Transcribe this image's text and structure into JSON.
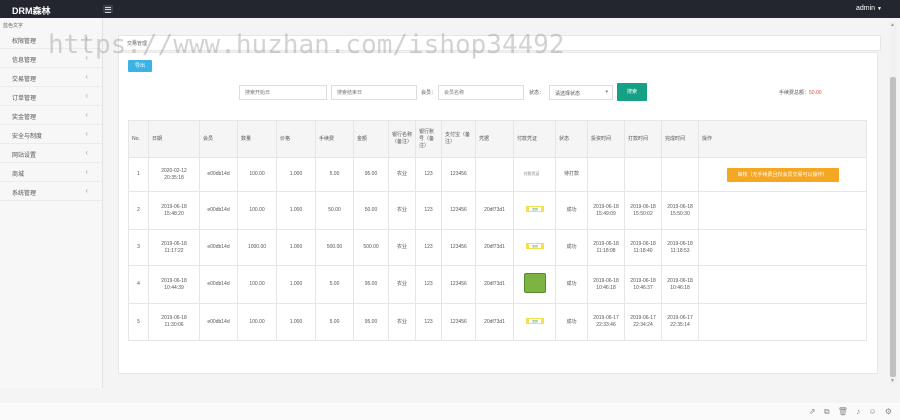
{
  "app": {
    "title": "DRM森林",
    "user": "admin"
  },
  "sidebar": {
    "title": "蓝色文字",
    "items": [
      {
        "label": "权限管理"
      },
      {
        "label": "信息管理"
      },
      {
        "label": "交易管理"
      },
      {
        "label": "订单管理"
      },
      {
        "label": "奖金管理"
      },
      {
        "label": "安全与制度"
      },
      {
        "label": "网站设置"
      },
      {
        "label": "商城"
      },
      {
        "label": "系统管理"
      }
    ]
  },
  "tab": {
    "label": "交易管理"
  },
  "toolbar": {
    "export_label": "导出"
  },
  "search": {
    "start_placeholder": "搜索开始日",
    "end_placeholder": "搜索结束日",
    "member_label": "会员：",
    "member_placeholder": "会员名称",
    "status_label": "状态：",
    "status_value": "请选择状态",
    "search_label": "搜索"
  },
  "summary": {
    "fee_label": "手续费总额：",
    "fee_value": "50.00"
  },
  "table": {
    "columns": [
      "No.",
      "日期",
      "会员",
      "数量",
      "价格",
      "手续费",
      "金额",
      "银行名称（备注）",
      "银行账号（备注）",
      "支付宝（备注）",
      "凭据",
      "付款凭证",
      "状态",
      "投资时间",
      "打款时间",
      "完成时间",
      "操作"
    ],
    "rows": [
      {
        "no": "1",
        "date": "2020-02-12 20:35:18",
        "member": "e00db14d",
        "qty": "100.00",
        "price": "1.000",
        "fee": "5.00",
        "amount": "95.00",
        "bank": "农业",
        "account": "123",
        "alipay": "123456",
        "cert": "",
        "voucher": "付款凭证",
        "status": "待打款",
        "invest_time": "",
        "pay_time": "",
        "done_time": "",
        "action": "审核（无手续费且仅会员交易可以操作）"
      },
      {
        "no": "2",
        "date": "2019-06-18 15:48:20",
        "member": "e00db14d",
        "qty": "100.00",
        "price": "1.000",
        "fee": "50.00",
        "amount": "50.00",
        "bank": "农业",
        "account": "123",
        "alipay": "123456",
        "cert": "20df73d1",
        "voucher": "300",
        "status": "成功",
        "invest_time": "2019-06-18 15:49:09",
        "pay_time": "2019-06-18 15:50:02",
        "done_time": "2019-06-18 15:50:30",
        "action": ""
      },
      {
        "no": "3",
        "date": "2019-06-18 11:17:22",
        "member": "e00db14d",
        "qty": "1000.00",
        "price": "1.000",
        "fee": "500.00",
        "amount": "500.00",
        "bank": "农业",
        "account": "123",
        "alipay": "123456",
        "cert": "20df73d1",
        "voucher": "300",
        "status": "成功",
        "invest_time": "2019-06-18 11:18:08",
        "pay_time": "2019-06-18 11:18:40",
        "done_time": "2019-06-18 11:18:53",
        "action": ""
      },
      {
        "no": "4",
        "date": "2019-06-18 10:44:39",
        "member": "e00db14d",
        "qty": "100.00",
        "price": "1.000",
        "fee": "5.00",
        "amount": "95.00",
        "bank": "农业",
        "account": "123",
        "alipay": "123456",
        "cert": "20df73d1",
        "voucher": "",
        "status": "成功",
        "invest_time": "2019-06-18 10:46:18",
        "pay_time": "2019-06-18 10:46:37",
        "done_time": "2019-06-18 10:46:18",
        "action": ""
      },
      {
        "no": "5",
        "date": "2019-06-18 11:30:06",
        "member": "e00db14d",
        "qty": "100.00",
        "price": "1.000",
        "fee": "5.00",
        "amount": "95.00",
        "bank": "农业",
        "account": "123",
        "alipay": "123456",
        "cert": "20df73d1",
        "voucher": "300",
        "status": "成功",
        "invest_time": "2019-06-17 22:33:46",
        "pay_time": "2019-06-17 22:34:24",
        "done_time": "2019-06-17 22:35:14",
        "action": ""
      }
    ]
  },
  "watermark": "https://www.huzhan.com/ishop34492",
  "icons": [
    "share-icon",
    "copy-icon",
    "trash-icon",
    "sound-icon",
    "user-icon",
    "settings-icon"
  ],
  "colors": {
    "topbar": "#23262e",
    "export": "#3bb4e5",
    "search": "#16a085",
    "action": "#f5a623",
    "fee": "#e74c3c"
  }
}
